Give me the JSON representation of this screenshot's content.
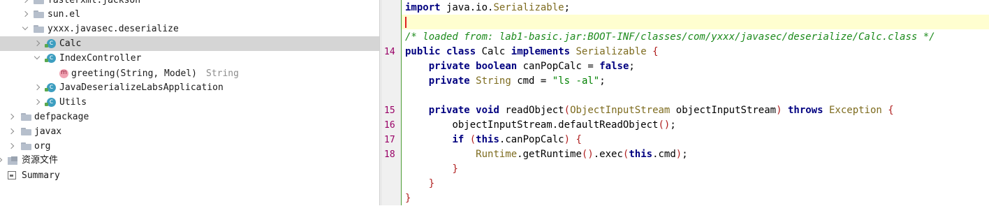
{
  "tree": {
    "items": [
      {
        "label": "fasterxml.jackson"
      },
      {
        "label": "sun.el"
      },
      {
        "label": "yxxx.javasec.deserialize"
      },
      {
        "label": "Calc"
      },
      {
        "label": "IndexController"
      },
      {
        "label": "greeting(String, Model)",
        "type": "String"
      },
      {
        "label": "JavaDeserializeLabsApplication"
      },
      {
        "label": "Utils"
      },
      {
        "label": "defpackage"
      },
      {
        "label": "javax"
      },
      {
        "label": "org"
      },
      {
        "label": "资源文件"
      },
      {
        "label": "Summary"
      }
    ]
  },
  "editor": {
    "line_numbers": [
      "14",
      "15",
      "16",
      "17",
      "18"
    ],
    "code": {
      "l1": {
        "kw": "import",
        "pkg": " java.io.",
        "cls": "Serializable",
        "end": ";"
      },
      "l3": "/* loaded from: lab1-basic.jar:BOOT-INF/classes/com/yxxx/javasec/deserialize/Calc.class */",
      "l4": {
        "kw1": "public",
        "kw2": "class",
        "name": "Calc",
        "kw3": "implements",
        "iface": "Serializable",
        "brace": "{"
      },
      "l5": {
        "kw1": "private",
        "kw2": "boolean",
        "name": "canPopCalc",
        "eq": "=",
        "kw3": "false",
        "end": ";"
      },
      "l6": {
        "kw1": "private",
        "type": "String",
        "name": "cmd",
        "eq": "=",
        "str": "\"ls -al\"",
        "end": ";"
      },
      "l8": {
        "kw1": "private",
        "kw2": "void",
        "name": "readObject",
        "ptype": "ObjectInputStream",
        "pname": "objectInputStream",
        "kw3": "throws",
        "exc": "Exception",
        "brace": "{"
      },
      "l9": "objectInputStream.defaultReadObject",
      "l10": {
        "kw1": "if",
        "kw2": "this",
        "field": ".canPopCalc"
      },
      "l11": {
        "cls": "Runtime",
        "call": ".getRuntime",
        "call2": ".exec",
        "kw": "this",
        "field": ".cmd"
      },
      "close": "}"
    }
  }
}
